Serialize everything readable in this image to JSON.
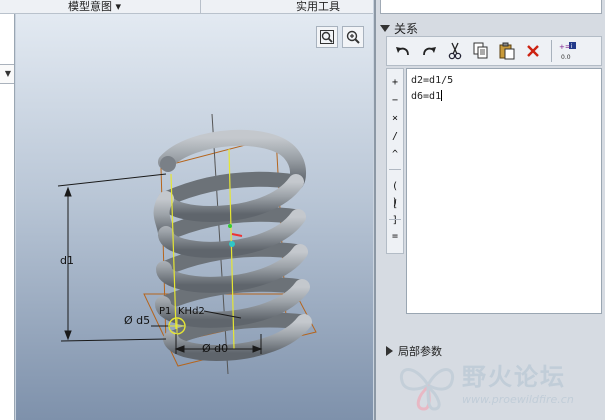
{
  "ribbon": {
    "tab_model_intent": "模型意图 ▾",
    "tab_utilities": "实用工具"
  },
  "viewport": {
    "dim_d1": "d1",
    "dim_d5": "Ø d5",
    "dim_d0": "Ø d0",
    "dim_pitch": "P1",
    "dim_pitch_value": "KHd2"
  },
  "relations": {
    "section_title": "关系",
    "lines": [
      "d2=d1/5",
      "d6=d1"
    ],
    "local_params_label": "局部参数"
  },
  "operators": [
    "+",
    "−",
    "×",
    "/",
    "^",
    "( )",
    "[ ]",
    "="
  ],
  "watermark": {
    "name": "野火论坛",
    "url": "www.proewildfire.cn"
  },
  "colors": {
    "spring": "#8f969d",
    "dimension_line": "#1a1a1a",
    "datum_frame": "#b5651d",
    "axis": "#e6e633"
  }
}
